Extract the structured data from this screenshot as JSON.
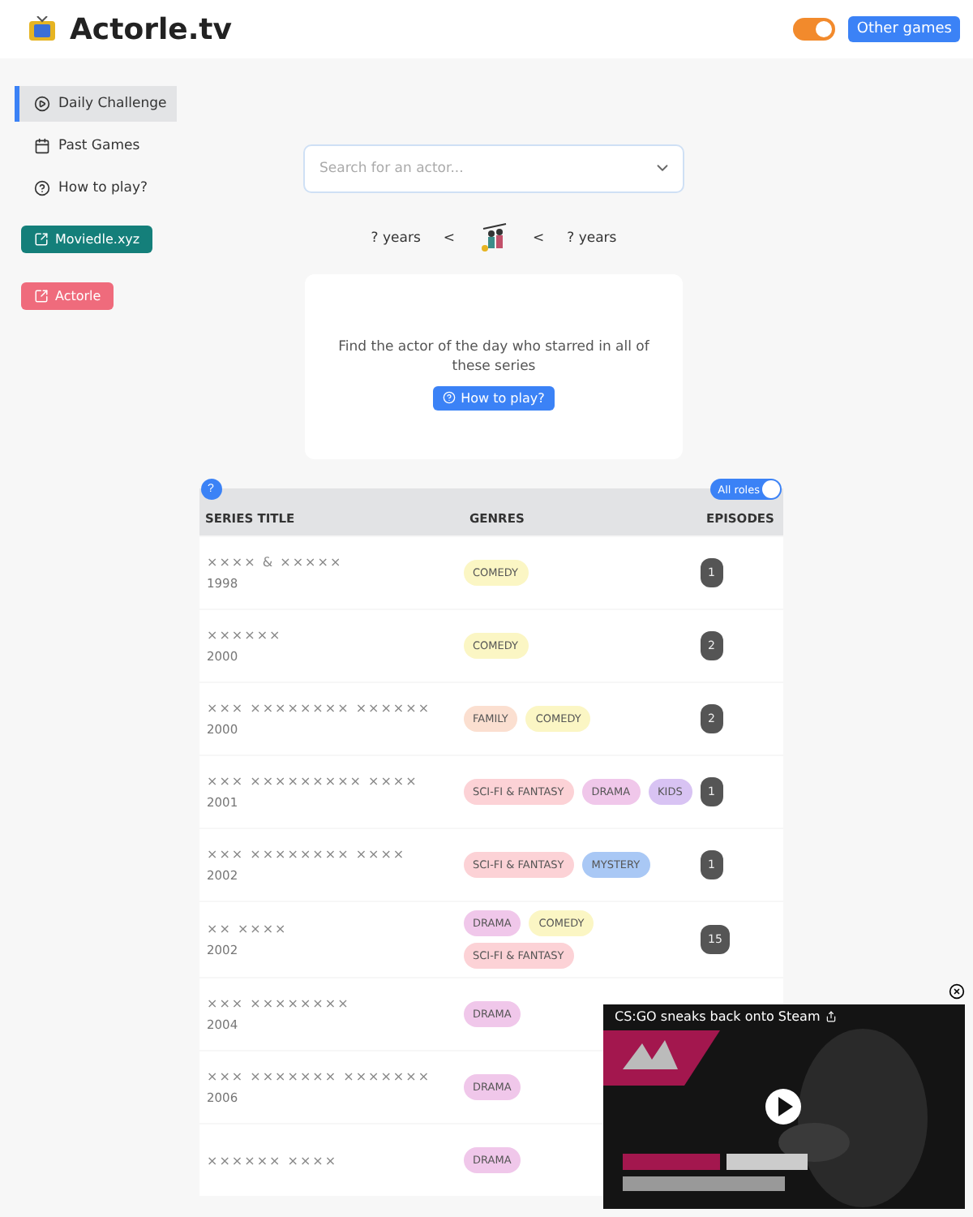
{
  "header": {
    "title": "Actorle.tv",
    "theme_toggle": {
      "on": true
    },
    "other_games": "Other games"
  },
  "sidebar": {
    "items": [
      {
        "label": "Daily Challenge",
        "selected": true
      },
      {
        "label": "Past Games",
        "selected": false
      },
      {
        "label": "How to play?",
        "selected": false
      }
    ],
    "links": [
      {
        "label": "Moviedle.xyz",
        "color": "#147f7a"
      },
      {
        "label": "Actorle",
        "color": "#ef6b7c"
      }
    ]
  },
  "search": {
    "placeholder": "Search for an actor..."
  },
  "age": {
    "min": "? years",
    "lt1": "<",
    "lt2": "<",
    "max": "? years"
  },
  "intro": {
    "text": "Find the actor of the day who starred in all of these series",
    "button": "How to play?"
  },
  "table": {
    "help": "?",
    "all_roles": {
      "label": "All roles",
      "on": true
    },
    "columns": [
      "SERIES TITLE",
      "GENRES",
      "EPISODES"
    ],
    "rows": [
      {
        "title": "×××× & ×××××",
        "year": "1998",
        "genres": [
          {
            "label": "COMEDY",
            "color": "#fbf6c4"
          }
        ],
        "episodes": "1"
      },
      {
        "title": "××××××",
        "year": "2000",
        "genres": [
          {
            "label": "COMEDY",
            "color": "#fbf6c4"
          }
        ],
        "episodes": "2"
      },
      {
        "title": "××× ×××××××× ××××××",
        "year": "2000",
        "genres": [
          {
            "label": "FAMILY",
            "color": "#fbdfd0"
          },
          {
            "label": "COMEDY",
            "color": "#fbf6c4"
          }
        ],
        "episodes": "2"
      },
      {
        "title": "××× ××××××××× ××××",
        "year": "2001",
        "genres": [
          {
            "label": "SCI-FI & FANTASY",
            "color": "#fcd2d6"
          },
          {
            "label": "DRAMA",
            "color": "#f0c7ea"
          },
          {
            "label": "KIDS",
            "color": "#d8c3f3"
          }
        ],
        "episodes": "1"
      },
      {
        "title": "××× ×××××××× ××××",
        "year": "2002",
        "genres": [
          {
            "label": "SCI-FI & FANTASY",
            "color": "#fcd2d6"
          },
          {
            "label": "MYSTERY",
            "color": "#a9c8f5"
          }
        ],
        "episodes": "1"
      },
      {
        "title": "×× ××××",
        "year": "2002",
        "genres": [
          {
            "label": "DRAMA",
            "color": "#f0c7ea"
          },
          {
            "label": "COMEDY",
            "color": "#fbf6c4"
          },
          {
            "label": "SCI-FI & FANTASY",
            "color": "#fcd2d6"
          }
        ],
        "episodes": "15"
      },
      {
        "title": "××× ××××××××",
        "year": "2004",
        "genres": [
          {
            "label": "DRAMA",
            "color": "#f0c7ea"
          }
        ]
      },
      {
        "title": "××× ××××××× ×××××××",
        "year": "2006",
        "genres": [
          {
            "label": "DRAMA",
            "color": "#f0c7ea"
          }
        ]
      },
      {
        "title": "×××××× ××××",
        "genres": [
          {
            "label": "DRAMA",
            "color": "#f0c7ea"
          }
        ]
      }
    ]
  },
  "video": {
    "title": "CS:GO sneaks back onto Steam"
  }
}
